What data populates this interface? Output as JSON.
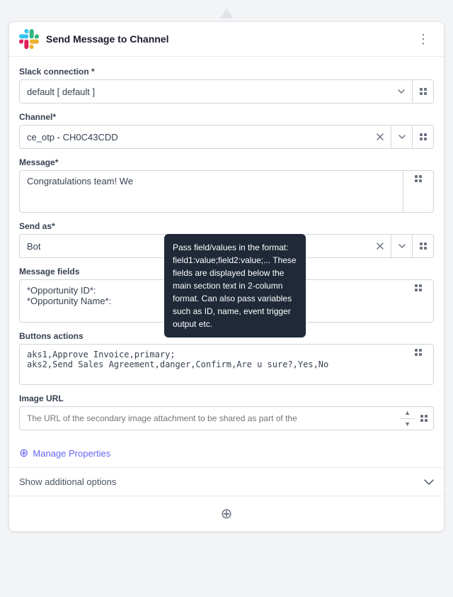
{
  "header": {
    "title": "Send Message to Channel",
    "kebab_icon": "⋮"
  },
  "slack_connection": {
    "label": "Slack connection *",
    "value": "default [ default ]"
  },
  "channel": {
    "label": "Channel*",
    "value": "ce_otp - CH0C43CDD"
  },
  "message": {
    "label": "Message*",
    "value": "Congratulations team! We"
  },
  "send_as": {
    "label": "Send as*",
    "value": "Bot"
  },
  "message_fields": {
    "label": "Message fields",
    "line1": "*Opportunity ID*:",
    "line2": "*Opportunity Name*:"
  },
  "buttons_actions": {
    "label": "Buttons actions",
    "line1": "aks1,Approve Invoice,primary;",
    "line2": "aks2,Send Sales Agreement,danger,Confirm,Are u sure?,Yes,No"
  },
  "image_url": {
    "label": "Image URL",
    "placeholder": "The URL of the secondary image attachment to be shared as part of the"
  },
  "manage_properties": {
    "label": "Manage Properties"
  },
  "show_additional": {
    "label": "Show additional options"
  },
  "tooltip": {
    "text": "Pass field/values in the format: field1:value;field2:value;... These fields are displayed below the main section text in 2-column format. Can also pass variables such as ID, name, event trigger output etc."
  },
  "add_button": {
    "icon": "⊕"
  }
}
